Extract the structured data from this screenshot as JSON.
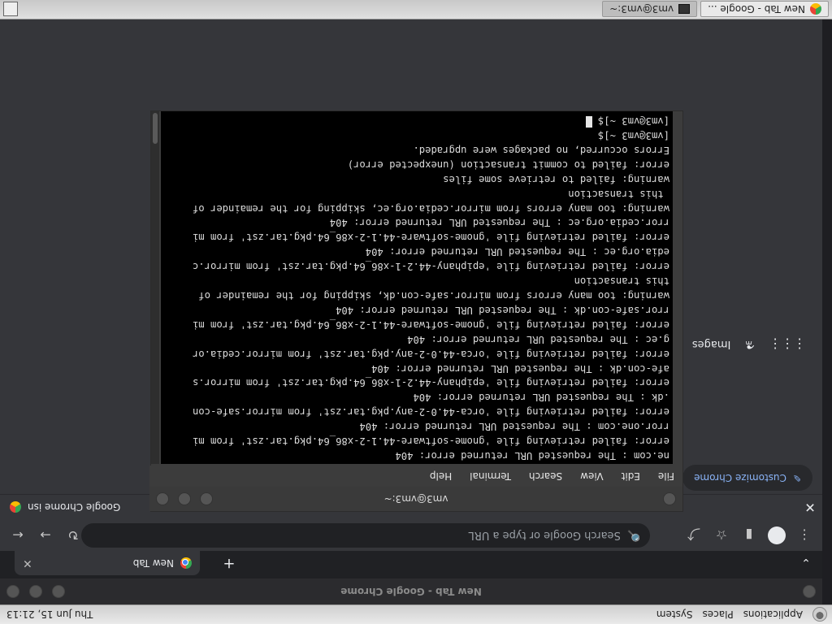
{
  "top_panel": {
    "menu": [
      "Applications",
      "Places",
      "System"
    ],
    "clock": "Thu Jun 15, 21:13"
  },
  "chrome": {
    "window_title": "New Tab - Google Chrome",
    "tab_title": "New Tab",
    "omnibox_placeholder": "Search Google or type a URL",
    "bookmark_text": "Google Chrome isn",
    "ntp_images_link": "Images",
    "customize_label": "Customize Chrome"
  },
  "terminal": {
    "title": "vm3@vm3:~",
    "menu": [
      "File",
      "Edit",
      "View",
      "Search",
      "Terminal",
      "Help"
    ],
    "lines": [
      "ne.com : The requested URL returned error: 404",
      "error: failed retrieving file 'gnome-software-44.1-2-x86_64.pkg.tar.zst' from mi",
      "rror.one.com : The requested URL returned error: 404",
      "error: failed retrieving file 'orca-44.0-2-any.pkg.tar.zst' from mirror.safe-con",
      ".dk : The requested URL returned error: 404",
      "error: failed retrieving file 'epiphany-44.2-1-x86_64.pkg.tar.zst' from mirror.s",
      "afe-con.dk : The requested URL returned error: 404",
      "error: failed retrieving file 'orca-44.0-2-any.pkg.tar.zst' from mirror.cedia.or",
      "g.ec : The requested URL returned error: 404",
      "error: failed retrieving file 'gnome-software-44.1-2-x86_64.pkg.tar.zst' from mi",
      "rror.safe-con.dk : The requested URL returned error: 404",
      "warning: too many errors from mirror.safe-con.dk, skipping for the remainder of",
      "this transaction",
      "error: failed retrieving file 'epiphany-44.2-1-x86_64.pkg.tar.zst' from mirror.c",
      "edia.org.ec : The requested URL returned error: 404",
      "error: failed retrieving file 'gnome-software-44.1-2-x86_64.pkg.tar.zst' from mi",
      "rror.cedia.org.ec : The requested URL returned error: 404",
      "warning: too many errors from mirror.cedia.org.ec, skipping for the remainder of",
      " this transaction",
      "warning: failed to retrieve some files",
      "error: failed to commit transaction (unexpected error)",
      "Errors occurred, no packages were upgraded.",
      "[vm3@vm3 ~]$",
      "[vm3@vm3 ~]$ "
    ]
  },
  "taskbar": {
    "tasks": [
      {
        "label": "New Tab - Google ...",
        "icon": "chrome-icon",
        "active": false
      },
      {
        "label": "vm3@vm3:~",
        "icon": "terminal-icon",
        "active": true
      }
    ]
  }
}
